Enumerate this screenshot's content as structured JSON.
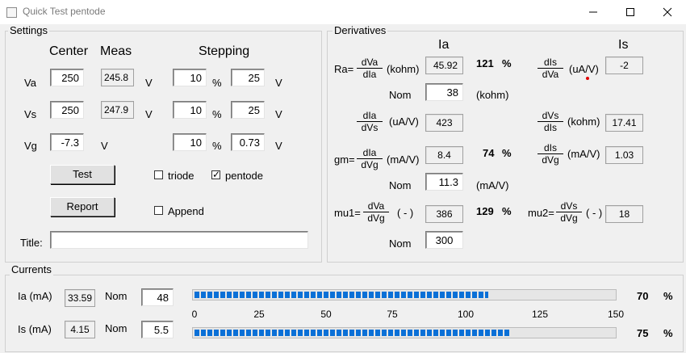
{
  "window": {
    "title": "Quick Test pentode"
  },
  "settings": {
    "group_title": "Settings",
    "headers": {
      "center": "Center",
      "meas": "Meas",
      "stepping": "Stepping"
    },
    "rows": [
      {
        "label": "Va",
        "center": "250",
        "meas": "245.8",
        "unit": "V",
        "step_pct": "10",
        "pct": "%",
        "step_val": "25",
        "unit2": "V"
      },
      {
        "label": "Vs",
        "center": "250",
        "meas": "247.9",
        "unit": "V",
        "step_pct": "10",
        "pct": "%",
        "step_val": "25",
        "unit2": "V"
      },
      {
        "label": "Vg",
        "center": "-7.3",
        "unit": "V",
        "step_pct": "10",
        "pct": "%",
        "step_val": "0.73",
        "unit2": "V"
      }
    ],
    "test_button": "Test",
    "report_button": "Report",
    "triode_label": "triode",
    "triode_checked": false,
    "pentode_label": "pentode",
    "pentode_checked": true,
    "pentode_mark": "✓",
    "append_label": "Append",
    "append_checked": false,
    "title_label": "Title:",
    "title_value": ""
  },
  "derivatives": {
    "group_title": "Derivatives",
    "col_ia": "Ia",
    "col_is": "Is",
    "ra": {
      "prefix": "Ra=",
      "num": "dVa",
      "den": "dIa",
      "unit": "(kohm)",
      "value": "45.92",
      "pct": "121",
      "pct_sign": "%",
      "nom_label": "Nom",
      "nom_value": "38",
      "nom_unit": "(kohm)"
    },
    "dis_dva": {
      "num": "dIs",
      "den": "dVa",
      "unit": "(uA/V)",
      "value": "-2"
    },
    "dia_dvs": {
      "num": "dIa",
      "den": "dVs",
      "unit": "(uA/V)",
      "value": "423"
    },
    "dvs_dis": {
      "num": "dVs",
      "den": "dIs",
      "unit": "(kohm)",
      "value": "17.41"
    },
    "gm": {
      "prefix": "gm=",
      "num": "dIa",
      "den": "dVg",
      "unit": "(mA/V)",
      "value": "8.4",
      "pct": "74",
      "pct_sign": "%",
      "nom_label": "Nom",
      "nom_value": "11.3",
      "nom_unit": "(mA/V)"
    },
    "dis_dvg": {
      "num": "dIs",
      "den": "dVg",
      "unit": "(mA/V)",
      "value": "1.03"
    },
    "mu1": {
      "prefix": "mu1=",
      "num": "dVa",
      "den": "dVg",
      "unit": "( - )",
      "value": "386",
      "pct": "129",
      "pct_sign": "%",
      "nom_label": "Nom",
      "nom_value": "300"
    },
    "mu2": {
      "prefix": "mu2=",
      "num": "dVs",
      "den": "dVg",
      "unit": "( - )",
      "value": "18"
    }
  },
  "currents": {
    "group_title": "Currents",
    "ia": {
      "label": "Ia (mA)",
      "value": "33.59",
      "nom_label": "Nom",
      "nom_value": "48",
      "bar_value": 33.59,
      "pct": "70",
      "pct_sign": "%"
    },
    "is": {
      "label": "Is (mA)",
      "value": "4.15",
      "nom_label": "Nom",
      "nom_value": "5.5",
      "bar_value": 4.15,
      "pct": "75",
      "pct_sign": "%"
    },
    "scale_ticks": [
      "0",
      "25",
      "50",
      "75",
      "100",
      "125",
      "150"
    ],
    "ia_bar_fraction": 0.7,
    "is_bar_fraction": 0.75
  },
  "colors": {
    "progress": "#0a70d7",
    "accent_dot": "#e00000"
  }
}
